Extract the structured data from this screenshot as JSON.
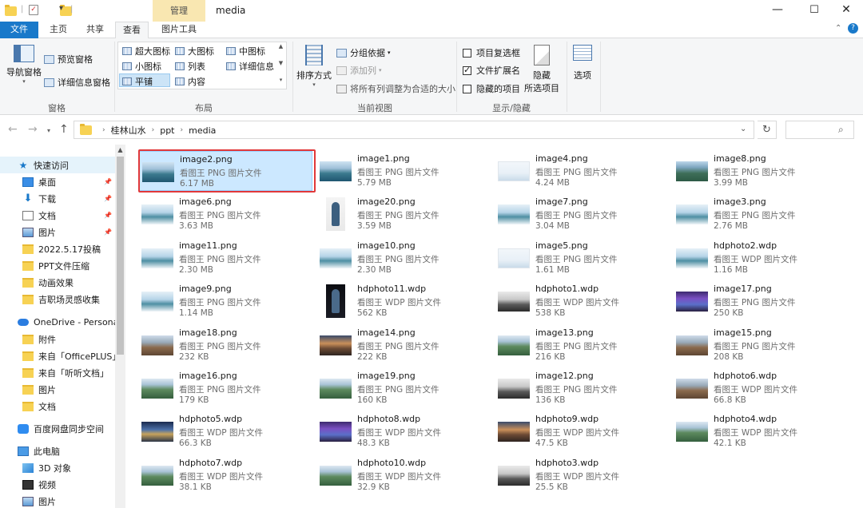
{
  "titlebar": {
    "context_tab": "管理",
    "title": "media",
    "minimize": "—",
    "maximize": "☐",
    "close": "✕"
  },
  "tabs": [
    "文件",
    "主页",
    "共享",
    "查看",
    "图片工具"
  ],
  "ribbon": {
    "panes": {
      "nav_pane": "导航窗格",
      "preview_pane": "预览窗格",
      "details_pane": "详细信息窗格",
      "label": "窗格"
    },
    "layout": {
      "items": [
        "超大图标",
        "大图标",
        "中图标",
        "小图标",
        "列表",
        "详细信息",
        "平铺",
        "内容"
      ],
      "selected": "平铺",
      "label": "布局"
    },
    "current_view": {
      "sort_by": "排序方式",
      "group_by": "分组依据",
      "add_columns": "添加列",
      "size_all_columns": "将所有列调整为合适的大小",
      "label": "当前视图"
    },
    "show_hide": {
      "item_checkboxes": "项目复选框",
      "file_extensions": "文件扩展名",
      "hidden_items": "隐藏的项目",
      "hide_selected": "隐藏",
      "hide_selected_2": "所选项目",
      "label": "显示/隐藏",
      "item_checkboxes_checked": false,
      "file_extensions_checked": true,
      "hidden_items_checked": false
    },
    "options": "选项"
  },
  "address": {
    "crumbs": [
      "桂林山水",
      "ppt",
      "media"
    ]
  },
  "nav": {
    "items": [
      {
        "label": "快速访问",
        "icon": "star-icon",
        "pinned": false
      },
      {
        "label": "桌面",
        "icon": "desktop-icon",
        "pinned": true
      },
      {
        "label": "下载",
        "icon": "download-icon",
        "pinned": true
      },
      {
        "label": "文档",
        "icon": "document-icon",
        "pinned": true
      },
      {
        "label": "图片",
        "icon": "picture-icon",
        "pinned": true
      },
      {
        "label": "2022.5.17投稿",
        "icon": "folder-icon",
        "pinned": false
      },
      {
        "label": "PPT文件压缩",
        "icon": "folder-icon",
        "pinned": false
      },
      {
        "label": "动画效果",
        "icon": "folder-icon",
        "pinned": false
      },
      {
        "label": "吉职场灵感收集",
        "icon": "folder-icon",
        "pinned": false
      },
      {
        "label": "OneDrive - Personal",
        "icon": "cloud-icon",
        "pinned": false
      },
      {
        "label": "附件",
        "icon": "folder-icon",
        "pinned": false
      },
      {
        "label": "来自「OfficePLUS」",
        "icon": "folder-icon",
        "pinned": false
      },
      {
        "label": "来自「听听文档」",
        "icon": "folder-icon",
        "pinned": false
      },
      {
        "label": "图片",
        "icon": "folder-icon",
        "pinned": false
      },
      {
        "label": "文档",
        "icon": "folder-icon",
        "pinned": false
      },
      {
        "label": "百度网盘同步空间",
        "icon": "baidu-cloud-icon",
        "pinned": false
      },
      {
        "label": "此电脑",
        "icon": "computer-icon",
        "pinned": false
      },
      {
        "label": "3D 对象",
        "icon": "cube-icon",
        "pinned": false
      },
      {
        "label": "视频",
        "icon": "video-icon",
        "pinned": false
      },
      {
        "label": "图片",
        "icon": "picture-icon",
        "pinned": false
      }
    ]
  },
  "files": [
    {
      "name": "image2.png",
      "type": "看图王 PNG 图片文件",
      "size": "6.17 MB",
      "thumb": "th-lake",
      "selected": true
    },
    {
      "name": "image1.png",
      "type": "看图王 PNG 图片文件",
      "size": "5.79 MB",
      "thumb": "th-lake"
    },
    {
      "name": "image4.png",
      "type": "看图王 PNG 图片文件",
      "size": "4.24 MB",
      "thumb": "th-pale"
    },
    {
      "name": "image8.png",
      "type": "看图王 PNG 图片文件",
      "size": "3.99 MB",
      "thumb": "th-hill"
    },
    {
      "name": "image6.png",
      "type": "看图王 PNG 图片文件",
      "size": "3.63 MB",
      "thumb": "th-lake2"
    },
    {
      "name": "image20.png",
      "type": "看图王 PNG 图片文件",
      "size": "3.59 MB",
      "thumb": "th-person"
    },
    {
      "name": "image7.png",
      "type": "看图王 PNG 图片文件",
      "size": "3.04 MB",
      "thumb": "th-lake2"
    },
    {
      "name": "image3.png",
      "type": "看图王 PNG 图片文件",
      "size": "2.76 MB",
      "thumb": "th-lake2"
    },
    {
      "name": "image11.png",
      "type": "看图王 PNG 图片文件",
      "size": "2.30 MB",
      "thumb": "th-lake2"
    },
    {
      "name": "image10.png",
      "type": "看图王 PNG 图片文件",
      "size": "2.30 MB",
      "thumb": "th-lake2"
    },
    {
      "name": "image5.png",
      "type": "看图王 PNG 图片文件",
      "size": "1.61 MB",
      "thumb": "th-pale"
    },
    {
      "name": "hdphoto2.wdp",
      "type": "看图王 WDP 图片文件",
      "size": "1.16 MB",
      "thumb": "th-lake2"
    },
    {
      "name": "image9.png",
      "type": "看图王 PNG 图片文件",
      "size": "1.14 MB",
      "thumb": "th-lake2"
    },
    {
      "name": "hdphoto11.wdp",
      "type": "看图王 WDP 图片文件",
      "size": "562 KB",
      "thumb": "th-dark"
    },
    {
      "name": "hdphoto1.wdp",
      "type": "看图王 WDP 图片文件",
      "size": "538 KB",
      "thumb": "th-bw"
    },
    {
      "name": "image17.png",
      "type": "看图王 PNG 图片文件",
      "size": "250 KB",
      "thumb": "th-purple"
    },
    {
      "name": "image18.png",
      "type": "看图王 PNG 图片文件",
      "size": "232 KB",
      "thumb": "th-town"
    },
    {
      "name": "image14.png",
      "type": "看图王 PNG 图片文件",
      "size": "222 KB",
      "thumb": "th-dusk"
    },
    {
      "name": "image13.png",
      "type": "看图王 PNG 图片文件",
      "size": "216 KB",
      "thumb": "th-karst"
    },
    {
      "name": "image15.png",
      "type": "看图王 PNG 图片文件",
      "size": "208 KB",
      "thumb": "th-town"
    },
    {
      "name": "image16.png",
      "type": "看图王 PNG 图片文件",
      "size": "179 KB",
      "thumb": "th-karst"
    },
    {
      "name": "image19.png",
      "type": "看图王 PNG 图片文件",
      "size": "160 KB",
      "thumb": "th-karst"
    },
    {
      "name": "image12.png",
      "type": "看图王 PNG 图片文件",
      "size": "136 KB",
      "thumb": "th-bw"
    },
    {
      "name": "hdphoto6.wdp",
      "type": "看图王 WDP 图片文件",
      "size": "66.8 KB",
      "thumb": "th-town"
    },
    {
      "name": "hdphoto5.wdp",
      "type": "看图王 WDP 图片文件",
      "size": "66.3 KB",
      "thumb": "th-night"
    },
    {
      "name": "hdphoto8.wdp",
      "type": "看图王 WDP 图片文件",
      "size": "48.3 KB",
      "thumb": "th-purple"
    },
    {
      "name": "hdphoto9.wdp",
      "type": "看图王 WDP 图片文件",
      "size": "47.5 KB",
      "thumb": "th-dusk"
    },
    {
      "name": "hdphoto4.wdp",
      "type": "看图王 WDP 图片文件",
      "size": "42.1 KB",
      "thumb": "th-karst"
    },
    {
      "name": "hdphoto7.wdp",
      "type": "看图王 WDP 图片文件",
      "size": "38.1 KB",
      "thumb": "th-karst"
    },
    {
      "name": "hdphoto10.wdp",
      "type": "看图王 WDP 图片文件",
      "size": "32.9 KB",
      "thumb": "th-karst"
    },
    {
      "name": "hdphoto3.wdp",
      "type": "看图王 WDP 图片文件",
      "size": "25.5 KB",
      "thumb": "th-bw"
    }
  ],
  "colors": {
    "accent": "#1979ca",
    "selection_fill": "#cce8ff",
    "highlight_outline": "#e1383a",
    "context_tab": "#f9e7b1"
  }
}
